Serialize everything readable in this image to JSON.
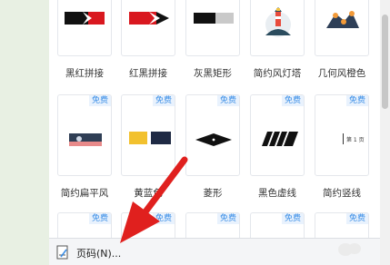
{
  "gallery": {
    "row1": [
      {
        "label": "黑红拼接"
      },
      {
        "label": "红黑拼接"
      },
      {
        "label": "灰黑矩形"
      },
      {
        "label": "简约风灯塔"
      },
      {
        "label": "几何风橙色"
      }
    ],
    "row2": [
      {
        "label": "简约扁平风",
        "badge": "免费"
      },
      {
        "label": "黄蓝色",
        "badge": "免费"
      },
      {
        "label": "菱形",
        "badge": "免费"
      },
      {
        "label": "黑色虚线",
        "badge": "免费"
      },
      {
        "label": "简约竖线",
        "badge": "免费",
        "inner_text": "第 1 页"
      }
    ],
    "row3": [
      {
        "badge": "免费"
      },
      {
        "badge": "免费"
      },
      {
        "badge": "免费"
      },
      {
        "badge": "免费"
      },
      {
        "badge": "免费"
      }
    ]
  },
  "footer": {
    "label": "页码(N)...",
    "icon": "page-number-icon"
  },
  "colors": {
    "red": "#d9181f",
    "black": "#111111",
    "badge": "#3a8ee6",
    "arrow": "#e0201e"
  }
}
